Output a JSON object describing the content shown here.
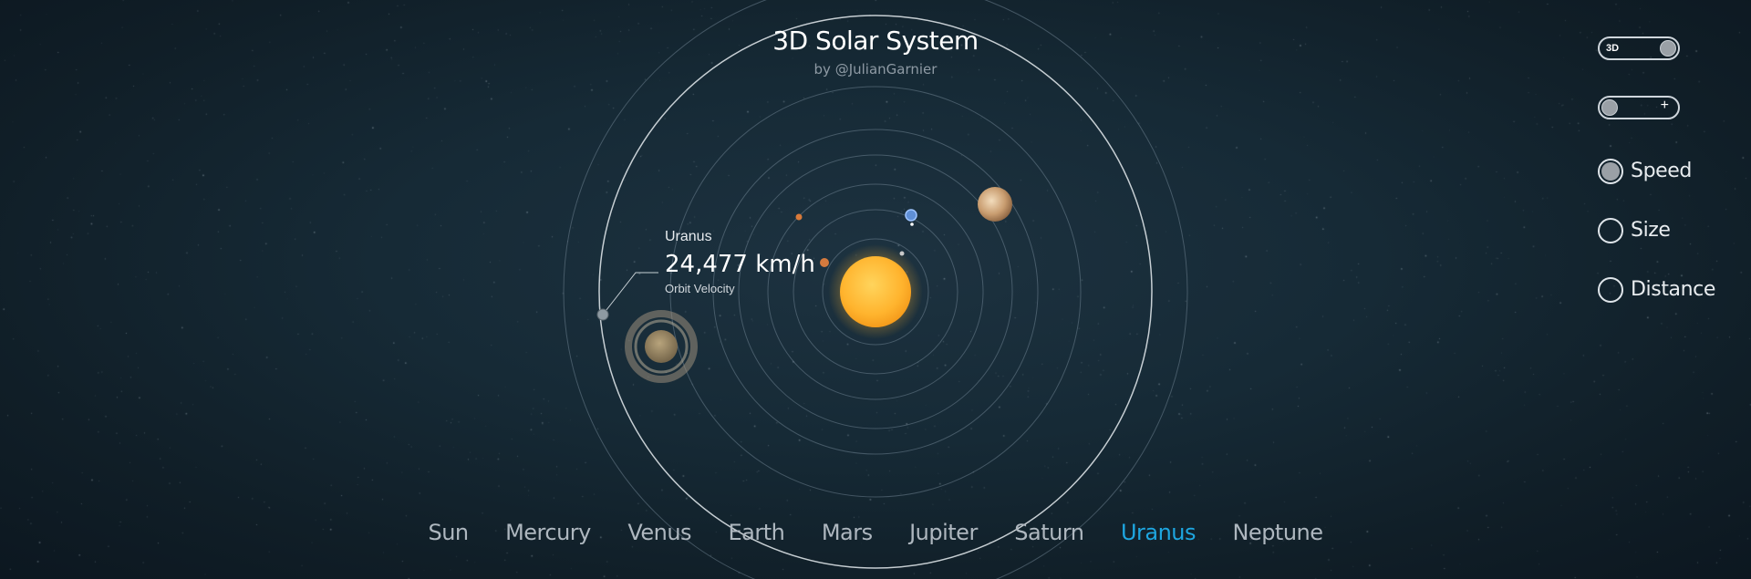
{
  "header": {
    "title": "3D Solar System",
    "subtitle": "by @JulianGarnier"
  },
  "planet_info": {
    "name": "Uranus",
    "value": "24,477 km/h",
    "label": "Orbit Velocity"
  },
  "controls": {
    "view_toggle": {
      "label": "3D",
      "state": "on"
    },
    "zoom_toggle": {
      "label": "+",
      "state": "off"
    },
    "modes": [
      {
        "label": "Speed",
        "selected": true
      },
      {
        "label": "Size",
        "selected": false
      },
      {
        "label": "Distance",
        "selected": false
      }
    ]
  },
  "nav": {
    "items": [
      "Sun",
      "Mercury",
      "Venus",
      "Earth",
      "Mars",
      "Jupiter",
      "Saturn",
      "Uranus",
      "Neptune"
    ],
    "active": "Uranus"
  },
  "colors": {
    "background": "#152733",
    "sun": "#ffb42e",
    "accent": "#1ea6e0",
    "orbit": "#8fa2b0",
    "uranus_orbit": "#e6ecf0"
  }
}
